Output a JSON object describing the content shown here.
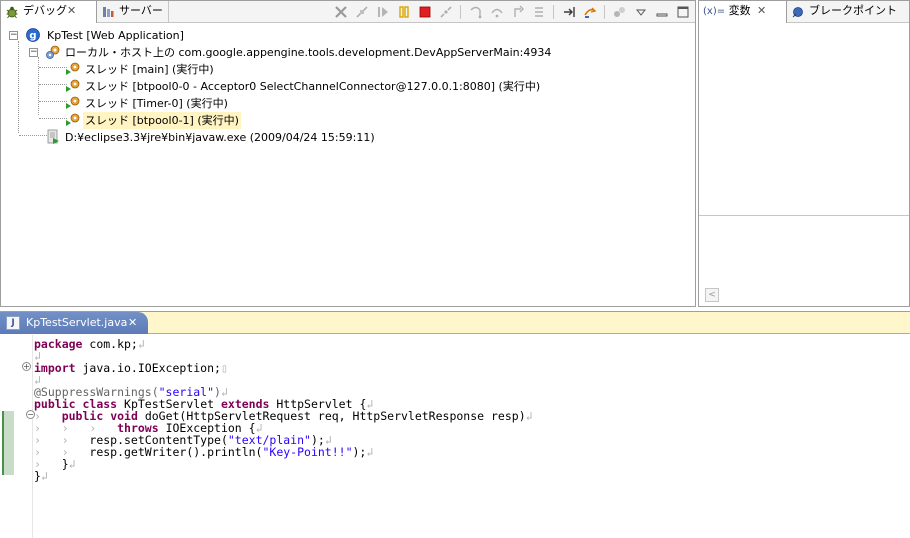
{
  "debug_view": {
    "tabs": [
      {
        "label": "デバッグ",
        "icon": "debug-bug-icon",
        "active": true
      },
      {
        "label": "サーバー",
        "icon": "servers-icon",
        "active": false
      }
    ],
    "toolbar_icons": [
      "remove-terminated-icon",
      "connect-icon",
      "resume-icon",
      "suspend-icon",
      "terminate-icon",
      "disconnect-icon",
      "step-into-icon",
      "step-over-icon",
      "step-return-icon",
      "drop-to-frame-icon",
      "use-step-filters-icon",
      "instruction-stepping-icon",
      "threads-icon",
      "view-menu-icon",
      "minimize-icon",
      "maximize-icon"
    ],
    "tree": {
      "launch": "KpTest [Web Application]",
      "target": "ローカル・ホスト上の com.google.appengine.tools.development.DevAppServerMain:4934",
      "threads": [
        "スレッド [main] (実行中)",
        "スレッド [btpool0-0 - Acceptor0 SelectChannelConnector@127.0.0.1:8080] (実行中)",
        "スレッド [Timer-0] (実行中)",
        "スレッド [btpool0-1] (実行中)"
      ],
      "process": "D:¥eclipse3.3¥jre¥bin¥javaw.exe (2009/04/24 15:59:11)"
    }
  },
  "vars_view": {
    "tabs": [
      {
        "label": "変数",
        "prefix": "(x)=",
        "active": true
      },
      {
        "label": "ブレークポイント",
        "icon": "breakpoint-icon",
        "active": false
      }
    ]
  },
  "editor": {
    "tab_label": "KpTestServlet.java",
    "code": {
      "l1_kw": "package",
      "l1_rest": " com.kp;",
      "l3_kw": "import",
      "l3_rest": " java.io.IOException;",
      "l5": "@SuppressWarnings(",
      "l5_str": "\"serial\"",
      "l5_end": ")",
      "l6_kw1": "public",
      "l6_kw2": "class",
      "l6_name": " KpTestServlet ",
      "l6_kw3": "extends",
      "l6_rest": " HttpServlet {",
      "l7_kw1": "public",
      "l7_kw2": "void",
      "l7_rest": " doGet(HttpServletRequest req, HttpServletResponse resp)",
      "l8_kw": "throws",
      "l8_rest": " IOException {",
      "l9_a": "resp.setContentType(",
      "l9_str": "\"text/plain\"",
      "l9_b": ");",
      "l10_a": "resp.getWriter().println(",
      "l10_str": "\"Key-Point!!\"",
      "l10_b": ");",
      "l11": "}",
      "l12": "}"
    }
  }
}
